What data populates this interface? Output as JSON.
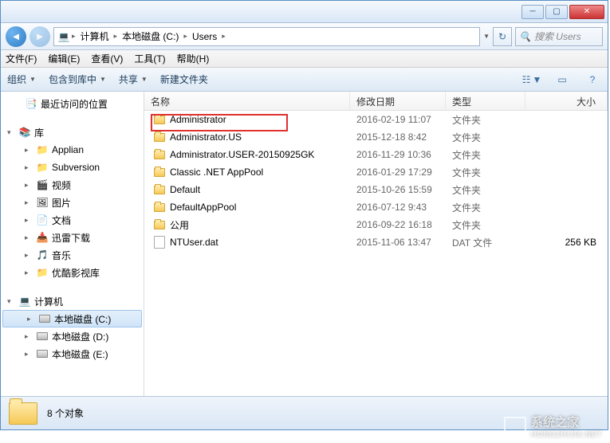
{
  "breadcrumbs": {
    "computer": "计算机",
    "drive": "本地磁盘 (C:)",
    "folder": "Users"
  },
  "search": {
    "placeholder": "搜索 Users"
  },
  "menu": {
    "file": "文件(F)",
    "edit": "编辑(E)",
    "view": "查看(V)",
    "tools": "工具(T)",
    "help": "帮助(H)"
  },
  "toolbar": {
    "organize": "组织",
    "include": "包含到库中",
    "share": "共享",
    "newfolder": "新建文件夹"
  },
  "cols": {
    "name": "名称",
    "date": "修改日期",
    "type": "类型",
    "size": "大小"
  },
  "tree": {
    "recent": "最近访问的位置",
    "libs": "库",
    "lib_items": [
      "Applian",
      "Subversion",
      "视频",
      "图片",
      "文档",
      "迅雷下载",
      "音乐",
      "优酷影视库"
    ],
    "computer": "计算机",
    "drives": [
      "本地磁盘 (C:)",
      "本地磁盘 (D:)",
      "本地磁盘 (E:)"
    ]
  },
  "rows": [
    {
      "name": "Administrator",
      "date": "2016-02-19 11:07",
      "type": "文件夹",
      "size": "",
      "icon": "folder",
      "hl": true
    },
    {
      "name": "Administrator.US",
      "date": "2015-12-18 8:42",
      "type": "文件夹",
      "size": "",
      "icon": "folder"
    },
    {
      "name": "Administrator.USER-20150925GK",
      "date": "2016-11-29 10:36",
      "type": "文件夹",
      "size": "",
      "icon": "folder"
    },
    {
      "name": "Classic .NET AppPool",
      "date": "2016-01-29 17:29",
      "type": "文件夹",
      "size": "",
      "icon": "folder"
    },
    {
      "name": "Default",
      "date": "2015-10-26 15:59",
      "type": "文件夹",
      "size": "",
      "icon": "folder"
    },
    {
      "name": "DefaultAppPool",
      "date": "2016-07-12 9:43",
      "type": "文件夹",
      "size": "",
      "icon": "folder"
    },
    {
      "name": "公用",
      "date": "2016-09-22 16:18",
      "type": "文件夹",
      "size": "",
      "icon": "folder"
    },
    {
      "name": "NTUser.dat",
      "date": "2015-11-06 13:47",
      "type": "DAT 文件",
      "size": "256 KB",
      "icon": "file"
    }
  ],
  "status": {
    "text": "8 个对象"
  },
  "watermark": {
    "name": "系统之家",
    "url": "HONGZHIJIA.NET"
  }
}
